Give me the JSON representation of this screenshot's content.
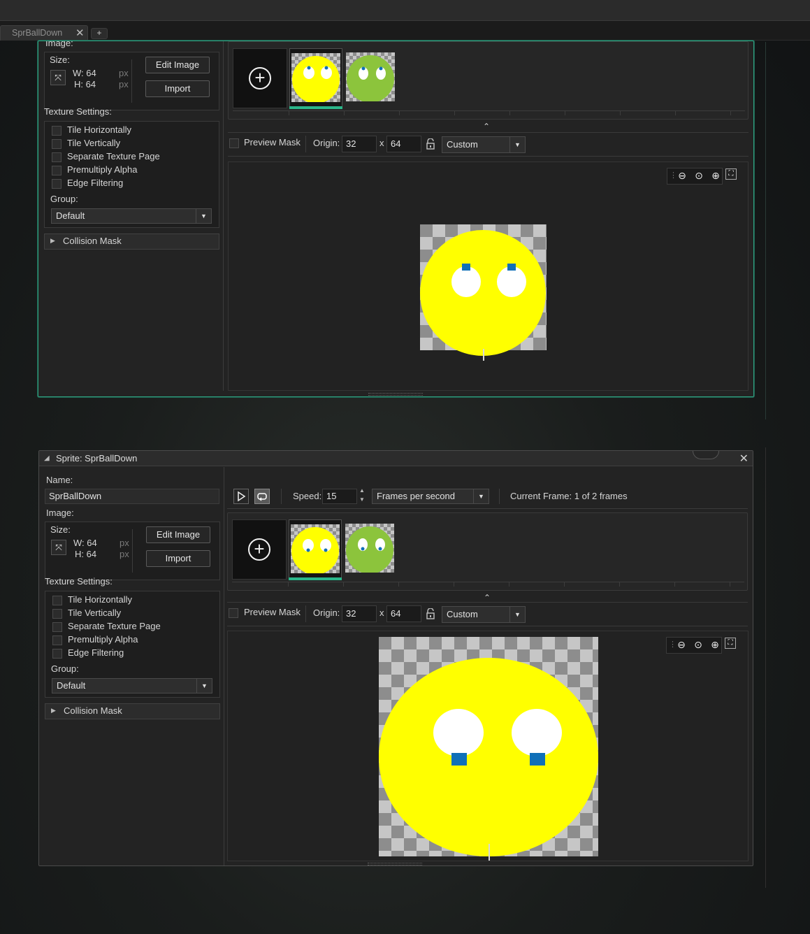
{
  "tab": {
    "label": "SprBallDown",
    "close": "✕",
    "add": "+"
  },
  "top_window": {
    "image_label": "Image:",
    "size_label": "Size:",
    "w_label": "W: 64",
    "h_label": "H: 64",
    "px1": "px",
    "px2": "px",
    "edit_image": "Edit Image",
    "import": "Import",
    "texture_label": "Texture Settings:",
    "checkboxes": [
      "Tile Horizontally",
      "Tile Vertically",
      "Separate Texture Page",
      "Premultiply Alpha",
      "Edge Filtering"
    ],
    "group_label": "Group:",
    "group_value": "Default",
    "collision_label": "Collision Mask",
    "preview_mask": "Preview Mask",
    "origin_label": "Origin:",
    "origin_x": "32",
    "origin_sep": "x",
    "origin_y": "64",
    "origin_preset": "Custom",
    "collapse_icon": "⌃"
  },
  "bottom_window": {
    "title": "Sprite: SprBallDown",
    "name_label": "Name:",
    "name_value": "SprBallDown",
    "speed_label": "Speed:",
    "speed_value": "15",
    "speed_unit": "Frames per second",
    "current_frame": "Current Frame: 1 of 2 frames",
    "image_label": "Image:",
    "size_label": "Size:",
    "w_label": "W: 64",
    "h_label": "H: 64",
    "px1": "px",
    "px2": "px",
    "edit_image": "Edit Image",
    "import": "Import",
    "texture_label": "Texture Settings:",
    "checkboxes": [
      "Tile Horizontally",
      "Tile Vertically",
      "Separate Texture Page",
      "Premultiply Alpha",
      "Edge Filtering"
    ],
    "group_label": "Group:",
    "group_value": "Default",
    "collision_label": "Collision Mask",
    "preview_mask": "Preview Mask",
    "origin_label": "Origin:",
    "origin_x": "32",
    "origin_sep": "x",
    "origin_y": "64",
    "origin_preset": "Custom"
  },
  "colors": {
    "accent": "#2bb68a",
    "sprite_yellow": "#ffff00",
    "sprite_green": "#8cc43c",
    "pupil_blue": "#1070b8"
  },
  "icons": [
    "add-frame-icon",
    "play-icon",
    "loop-icon",
    "fit-icon",
    "lock-icon",
    "zoom-out-icon",
    "zoom-reset-icon",
    "zoom-in-icon",
    "fullscreen-icon",
    "collapse-icon",
    "grip-icon"
  ]
}
